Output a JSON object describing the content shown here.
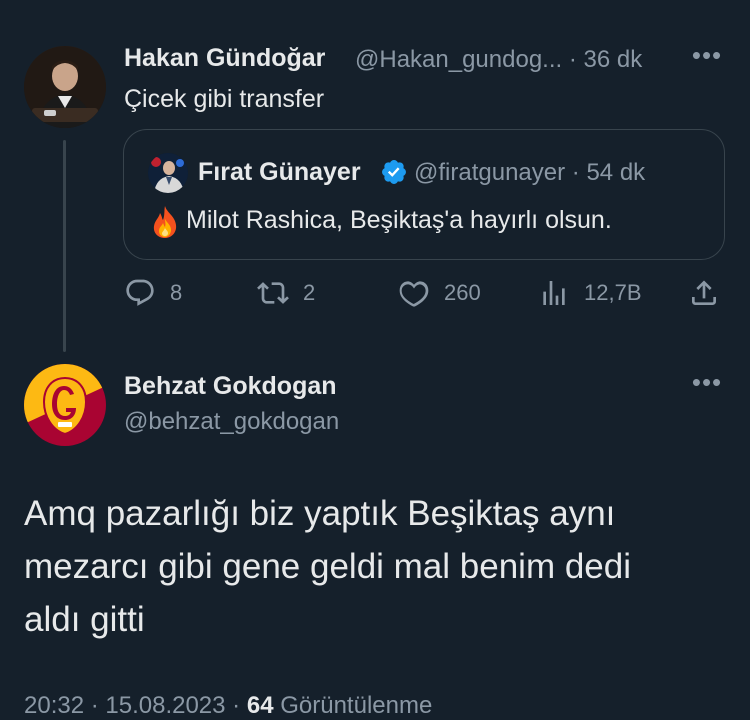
{
  "parent_tweet": {
    "name": "Hakan Gündoğar",
    "handle": "@Hakan_gundog...",
    "separator": "·",
    "time": "36 dk",
    "text": "Çicek gibi transfer",
    "quoted": {
      "name": "Fırat Günayer",
      "handle": "@firatgunayer",
      "separator": "·",
      "time": "54 dk",
      "text": "Milot Rashica, Beşiktaş'a hayırlı olsun."
    },
    "actions": {
      "replies": "8",
      "retweets": "2",
      "likes": "260",
      "views": "12,7B"
    }
  },
  "main_tweet": {
    "name": "Behzat Gokdogan",
    "handle": "@behzat_gokdogan",
    "text_lines": [
      "Amq pazarlığı biz yaptık Beşiktaş aynı",
      "mezarcı gibi gene geldi mal benim dedi",
      "aldı gitti"
    ],
    "timestamp": "20:32 · 15.08.2023 ·",
    "views_count": "64",
    "views_label": "Görüntülenme"
  },
  "colors": {
    "background": "#15202b",
    "text_primary": "#e7e9ea",
    "text_secondary": "#8b98a5",
    "border": "#38444d",
    "verified": "#1d9bf0",
    "galatasaray_yellow": "#fdb913",
    "galatasaray_red": "#a90432"
  },
  "icons": {
    "reply": "speech-bubble",
    "retweet": "retweet-arrows",
    "like": "heart-outline",
    "views": "bar-chart",
    "share": "upload-arrow",
    "more": "three-dots",
    "verified": "verified-badge",
    "fire": "fire-emoji"
  }
}
